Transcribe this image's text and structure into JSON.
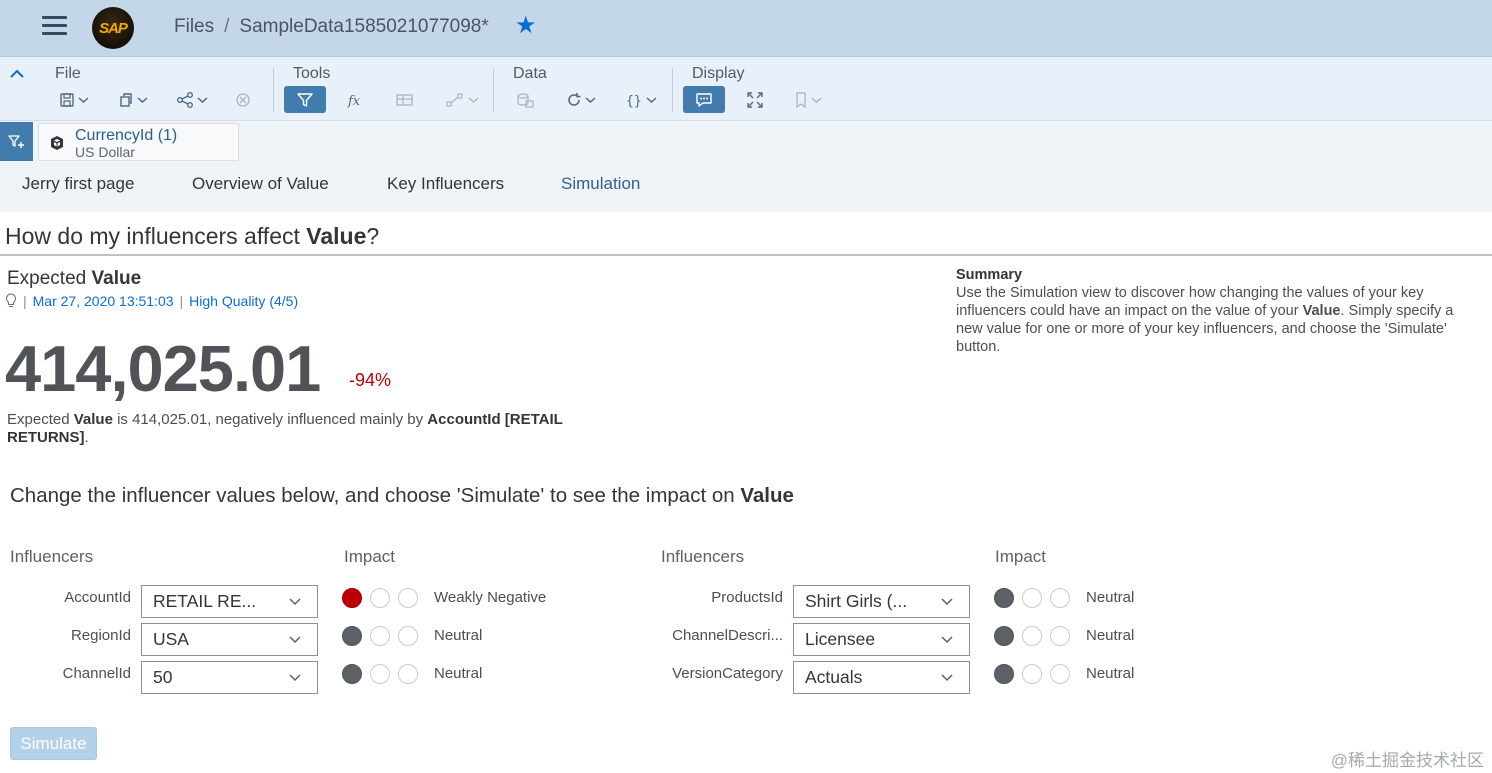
{
  "shell": {
    "logo_text": "SAP",
    "breadcrumb_root": "Files",
    "breadcrumb_sep": "/",
    "file_name": "SampleData1585021077098*"
  },
  "toolbar": {
    "groups": [
      {
        "title": "File"
      },
      {
        "title": "Tools"
      },
      {
        "title": "Data"
      },
      {
        "title": "Display"
      }
    ],
    "icons": {
      "file": [
        "save-icon",
        "copy-icon",
        "share-icon",
        "cancel-icon"
      ],
      "tools": [
        "filter-icon",
        "formula-icon",
        "table-icon",
        "hierarchy-icon"
      ],
      "data": [
        "data-source-icon",
        "refresh-icon",
        "braces-icon"
      ],
      "display": [
        "comment-icon",
        "fullscreen-icon",
        "bookmark-icon"
      ]
    }
  },
  "filter": {
    "title": "CurrencyId (1)",
    "value": "US Dollar"
  },
  "tabs": [
    {
      "label": "Jerry first page"
    },
    {
      "label": "Overview of Value"
    },
    {
      "label": "Key Influencers"
    },
    {
      "label": "Simulation"
    }
  ],
  "page": {
    "question_pre": "How do my influencers affect ",
    "question_bold": "Value",
    "question_post": "?",
    "expected_pre": "Expected ",
    "expected_bold": "Value",
    "timestamp": "Mar 27, 2020 13:51:03",
    "quality": "High Quality (4/5)",
    "big_value": "414,025.01",
    "delta": "-94%",
    "desc_pre": "Expected ",
    "desc_value": "Value",
    "desc_mid": " is 414,025.01, negatively influenced mainly by ",
    "desc_bold": "AccountId [RETAIL RETURNS]",
    "desc_post": ".",
    "change_pre": "Change the influencer values below, and choose 'Simulate' to see the impact on ",
    "change_bold": "Value"
  },
  "summary": {
    "heading": "Summary",
    "pre": "Use the Simulation view to discover how changing the values of your key influencers could have an impact on the value of your ",
    "bold": "Value",
    "post": ". Simply specify a new value for one or more of your key influencers, and choose the 'Simulate' button."
  },
  "influencers": {
    "col_influencers": "Influencers",
    "col_impact": "Impact",
    "left": [
      {
        "label": "AccountId",
        "value": "RETAIL RE...",
        "impact": "Weakly Negative"
      },
      {
        "label": "RegionId",
        "value": "USA",
        "impact": "Neutral"
      },
      {
        "label": "ChannelId",
        "value": "50",
        "impact": "Neutral"
      }
    ],
    "right": [
      {
        "label": "ProductsId",
        "value": "Shirt Girls (...",
        "impact": "Neutral"
      },
      {
        "label": "ChannelDescri...",
        "value": "Licensee",
        "impact": "Neutral"
      },
      {
        "label": "VersionCategory",
        "value": "Actuals",
        "impact": "Neutral"
      }
    ]
  },
  "simulate_label": "Simulate",
  "watermark": "@稀土掘金技术社区",
  "colors": {
    "accent": "#0a6ed1",
    "active_button": "#427cac",
    "negative": "#bb0000",
    "neutral": "#5b6167"
  }
}
